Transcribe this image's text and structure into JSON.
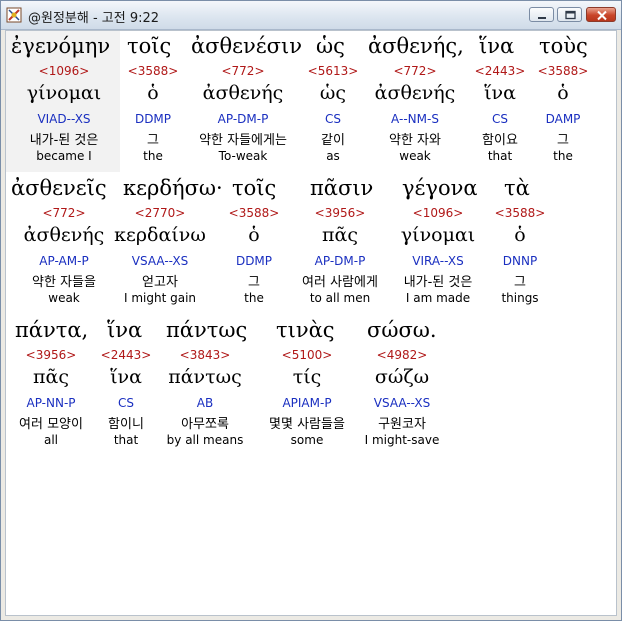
{
  "window": {
    "title": "@원정분해 - 고전 9:22"
  },
  "words": [
    {
      "greek": "ἐγενόμην",
      "num": "<1096>",
      "lemma": "γίνομαι",
      "parse": "VIAD--XS",
      "kor": "내가-된 것은",
      "eng": "became I"
    },
    {
      "greek": "τοῖς",
      "num": "<3588>",
      "lemma": "ὁ",
      "parse": "DDMP",
      "kor": "그",
      "eng": "the"
    },
    {
      "greek": "ἀσθενέσιν",
      "num": "<772>",
      "lemma": "ἀσθενής",
      "parse": "AP-DM-P",
      "kor": "약한 자들에게는",
      "eng": "To-weak"
    },
    {
      "greek": "ὡς",
      "num": "<5613>",
      "lemma": "ὡς",
      "parse": "CS",
      "kor": "같이",
      "eng": "as"
    },
    {
      "greek": "ἀσθενής,",
      "num": "<772>",
      "lemma": "ἀσθενής",
      "parse": "A--NM-S",
      "kor": "약한 자와",
      "eng": "weak"
    },
    {
      "greek": "ἵνα",
      "num": "<2443>",
      "lemma": "ἵνα",
      "parse": "CS",
      "kor": "함이요",
      "eng": "that"
    },
    {
      "greek": "τοὺς",
      "num": "<3588>",
      "lemma": "ὁ",
      "parse": "DAMP",
      "kor": "그",
      "eng": "the"
    },
    {
      "greek": "ἀσθενεῖς",
      "num": "<772>",
      "lemma": "ἀσθενής",
      "parse": "AP-AM-P",
      "kor": "약한 자들을",
      "eng": "weak"
    },
    {
      "greek": "κερδήσω·",
      "num": "<2770>",
      "lemma": "κερδαίνω",
      "parse": "VSAA--XS",
      "kor": "얻고자",
      "eng": "I might gain"
    },
    {
      "greek": "τοῖς",
      "num": "<3588>",
      "lemma": "ὁ",
      "parse": "DDMP",
      "kor": "그",
      "eng": "the"
    },
    {
      "greek": "πᾶσιν",
      "num": "<3956>",
      "lemma": "πᾶς",
      "parse": "AP-DM-P",
      "kor": "여러 사람에게",
      "eng": "to all men"
    },
    {
      "greek": "γέγονα",
      "num": "<1096>",
      "lemma": "γίνομαι",
      "parse": "VIRA--XS",
      "kor": "내가-된 것은",
      "eng": "I am made"
    },
    {
      "greek": "τὰ",
      "num": "<3588>",
      "lemma": "ὁ",
      "parse": "DNNP",
      "kor": "그",
      "eng": "things"
    },
    {
      "greek": "πάντα,",
      "num": "<3956>",
      "lemma": "πᾶς",
      "parse": "AP-NN-P",
      "kor": "여러 모양이",
      "eng": "all"
    },
    {
      "greek": "ἵνα",
      "num": "<2443>",
      "lemma": "ἵνα",
      "parse": "CS",
      "kor": "함이니",
      "eng": "that"
    },
    {
      "greek": "πάντως",
      "num": "<3843>",
      "lemma": "πάντως",
      "parse": "AB",
      "kor": "아무쪼록",
      "eng": "by all means"
    },
    {
      "greek": "τινὰς",
      "num": "<5100>",
      "lemma": "τίς",
      "parse": "APIAM-P",
      "kor": "몇몇 사람들을",
      "eng": "some"
    },
    {
      "greek": "σώσω.",
      "num": "<4982>",
      "lemma": "σώζω",
      "parse": "VSAA--XS",
      "kor": "구원코자",
      "eng": "I might-save"
    }
  ]
}
